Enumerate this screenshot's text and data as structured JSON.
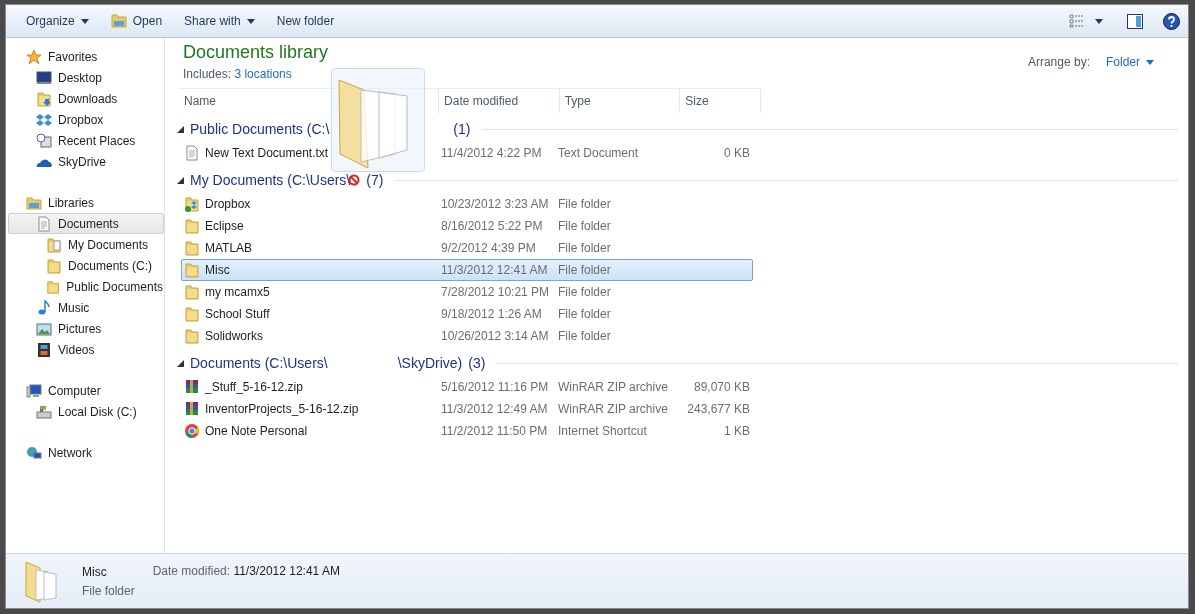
{
  "toolbar": {
    "buttons": [
      {
        "label": "Organize",
        "kind": "menu"
      },
      {
        "label": "Open",
        "kind": "open"
      },
      {
        "label": "Share with",
        "kind": "menu"
      },
      {
        "label": "New folder",
        "kind": "plain"
      }
    ]
  },
  "sidebar": {
    "sections": [
      {
        "label": "Favorites",
        "kind": "star",
        "items": [
          {
            "label": "Desktop",
            "kind": "desktop",
            "selected": false
          },
          {
            "label": "Downloads",
            "kind": "downloads",
            "selected": false
          },
          {
            "label": "Dropbox",
            "kind": "dropbox",
            "selected": false
          },
          {
            "label": "Recent Places",
            "kind": "recent",
            "selected": false
          },
          {
            "label": "SkyDrive",
            "kind": "cloud",
            "selected": false
          }
        ]
      },
      {
        "label": "Libraries",
        "kind": "library",
        "items": [
          {
            "label": "Documents",
            "kind": "document",
            "selected": true,
            "children": [
              {
                "label": "My Documents",
                "kind": "docfolder",
                "selected": false
              },
              {
                "label": "Documents (C:)",
                "kind": "folder",
                "selected": false
              },
              {
                "label": "Public Documents",
                "kind": "folder",
                "selected": false
              }
            ]
          },
          {
            "label": "Music",
            "kind": "music",
            "selected": false
          },
          {
            "label": "Pictures",
            "kind": "pictures",
            "selected": false
          },
          {
            "label": "Videos",
            "kind": "videos",
            "selected": false
          }
        ]
      },
      {
        "label": "Computer",
        "kind": "computer",
        "items": [
          {
            "label": "Local Disk (C:)",
            "kind": "disk",
            "selected": false
          }
        ]
      },
      {
        "label": "Network",
        "kind": "network"
      }
    ]
  },
  "library": {
    "title": "Documents library",
    "includes_label": "Includes:",
    "locations_link": "3 locations",
    "arrange_label": "Arrange by:",
    "arrange_value": "Folder"
  },
  "columns": [
    "Name",
    "Date modified",
    "Type",
    "Size"
  ],
  "groups": [
    {
      "title_parts": [
        "Public Documents (C:\\"
      ],
      "count": "(1)",
      "expanded": true,
      "items": [
        {
          "name": "New Text Document.txt",
          "date": "11/4/2012 4:22 PM",
          "type": "Text Document",
          "size": "0 KB",
          "kind": "text",
          "selected": false
        }
      ]
    },
    {
      "title_parts": [
        "My Documents (C:\\Users\\"
      ],
      "count": "(7)",
      "expanded": true,
      "items": [
        {
          "name": "Dropbox",
          "date": "10/23/2012 3:23 AM",
          "type": "File folder",
          "kind": "dropboxfolder",
          "selected": false
        },
        {
          "name": "Eclipse",
          "date": "8/16/2012 5:22 PM",
          "type": "File folder",
          "kind": "folder",
          "selected": false
        },
        {
          "name": "MATLAB",
          "date": "9/2/2012 4:39 PM",
          "type": "File folder",
          "kind": "folder",
          "selected": false
        },
        {
          "name": "Misc",
          "date": "11/3/2012 12:41 AM",
          "type": "File folder",
          "kind": "folder",
          "selected": true
        },
        {
          "name": "my mcamx5",
          "date": "7/28/2012 10:21 PM",
          "type": "File folder",
          "kind": "folder",
          "selected": false
        },
        {
          "name": "School Stuff",
          "date": "9/18/2012 1:26 AM",
          "type": "File folder",
          "kind": "folder",
          "selected": false
        },
        {
          "name": "Solidworks",
          "date": "10/26/2012 3:14 AM",
          "type": "File folder",
          "kind": "folder",
          "selected": false
        }
      ]
    },
    {
      "title_parts": [
        "Documents (C:\\Users\\",
        "\\SkyDrive)"
      ],
      "count": "(3)",
      "expanded": true,
      "items": [
        {
          "name": "_Stuff_5-16-12.zip",
          "date": "5/16/2012 11:16 PM",
          "type": "WinRAR ZIP archive",
          "size": "89,070 KB",
          "kind": "zip",
          "selected": false
        },
        {
          "name": "InventorProjects_5-16-12.zip",
          "date": "11/3/2012 12:49 AM",
          "type": "WinRAR ZIP archive",
          "size": "243,677 KB",
          "kind": "zip",
          "selected": false
        },
        {
          "name": "One Note Personal",
          "date": "11/2/2012 11:50 PM",
          "type": "Internet Shortcut",
          "size": "1 KB",
          "kind": "chrome",
          "selected": false
        }
      ]
    }
  ],
  "details": {
    "name": "Misc",
    "type": "File folder",
    "date_label": "Date modified:",
    "date_value": "11/3/2012 12:41 AM"
  }
}
